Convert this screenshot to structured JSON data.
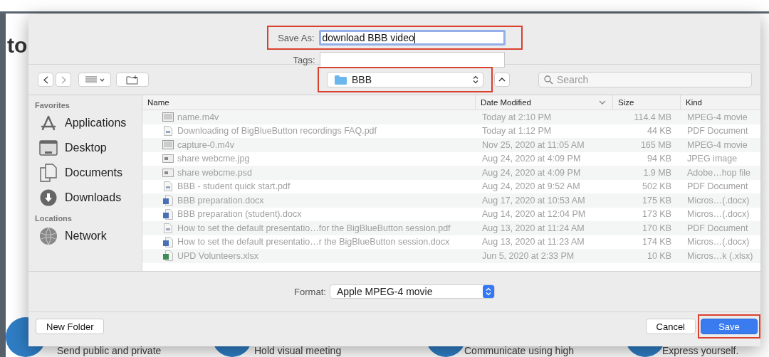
{
  "background": {
    "heading": "to",
    "features": [
      {
        "text": "Send public and private"
      },
      {
        "text": "Hold visual meeting"
      },
      {
        "text": "Communicate using high"
      },
      {
        "text": "Express yourself."
      }
    ]
  },
  "dialog": {
    "save_as": {
      "label": "Save As:",
      "value": "download BBB video",
      "highlighted": true
    },
    "tags": {
      "label": "Tags:"
    },
    "toolbar": {
      "location": {
        "value": "BBB",
        "highlighted": true
      },
      "search": {
        "placeholder": "Search"
      }
    },
    "sidebar": {
      "sections": [
        {
          "title": "Favorites",
          "items": [
            {
              "label": "Applications",
              "kind": "apps"
            },
            {
              "label": "Desktop",
              "kind": "desktop"
            },
            {
              "label": "Documents",
              "kind": "documents"
            },
            {
              "label": "Downloads",
              "kind": "downloads"
            }
          ]
        },
        {
          "title": "Locations",
          "items": [
            {
              "label": "Network",
              "kind": "network"
            }
          ]
        }
      ]
    },
    "table": {
      "columns": [
        {
          "label": "Name",
          "sorted": false
        },
        {
          "label": "Date Modified",
          "sorted": true
        },
        {
          "label": "Size",
          "sorted": false
        },
        {
          "label": "Kind",
          "sorted": false
        }
      ],
      "rows": [
        {
          "kind": "movie",
          "name": "name.m4v",
          "date": "Today at 2:10 PM",
          "size": "114.4 MB",
          "type": "MPEG-4 movie"
        },
        {
          "kind": "pdf",
          "name": "Downloading of BigBlueButton recordings FAQ.pdf",
          "date": "Today at 1:12 PM",
          "size": "44 KB",
          "type": "PDF Document"
        },
        {
          "kind": "movie",
          "name": "capture-0.m4v",
          "date": "Nov 25, 2020 at 11:05 AM",
          "size": "165 MB",
          "type": "MPEG-4 movie"
        },
        {
          "kind": "image",
          "name": "share webcme.jpg",
          "date": "Aug 24, 2020 at 4:09 PM",
          "size": "94 KB",
          "type": "JPEG image"
        },
        {
          "kind": "image",
          "name": "share webcme.psd",
          "date": "Aug 24, 2020 at 4:09 PM",
          "size": "1.9 MB",
          "type": "Adobe…hop file"
        },
        {
          "kind": "pdf",
          "name": "BBB - student quick start.pdf",
          "date": "Aug 24, 2020 at 9:52 AM",
          "size": "502 KB",
          "type": "PDF Document"
        },
        {
          "kind": "word",
          "name": "BBB preparation.docx",
          "date": "Aug 17, 2020 at 10:53 AM",
          "size": "175 KB",
          "type": "Micros…(.docx)"
        },
        {
          "kind": "word",
          "name": "BBB preparation (student).docx",
          "date": "Aug 14, 2020 at 12:04 PM",
          "size": "173 KB",
          "type": "Micros…(.docx)"
        },
        {
          "kind": "pdf",
          "name": "How to set the default presentatio…for the BigBlueButton session.pdf",
          "date": "Aug 13, 2020 at 11:24 AM",
          "size": "170 KB",
          "type": "PDF Document"
        },
        {
          "kind": "word",
          "name": "How to set the default presentatio…r the BigBlueButton session.docx",
          "date": "Aug 13, 2020 at 11:23 AM",
          "size": "174 KB",
          "type": "Micros…(.docx)"
        },
        {
          "kind": "excel",
          "name": "UPD Volunteers.xlsx",
          "date": "Jun 5, 2020 at 2:33 PM",
          "size": "10 KB",
          "type": "Micros…k (.xlsx)"
        }
      ]
    },
    "format": {
      "label": "Format:",
      "value": "Apple MPEG-4 movie"
    },
    "buttons": [
      {
        "label": "New Folder",
        "default": false,
        "highlighted": false
      },
      {
        "label": "Cancel",
        "default": false,
        "highlighted": false
      },
      {
        "label": "Save",
        "default": true,
        "highlighted": true
      }
    ]
  }
}
